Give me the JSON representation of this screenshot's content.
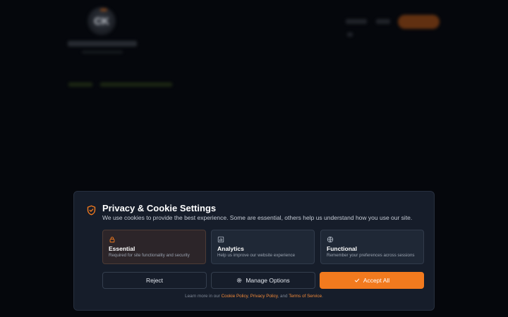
{
  "background": {
    "logo_initials": "CK"
  },
  "modal": {
    "title": "Privacy & Cookie Settings",
    "subtitle": "We use cookies to provide the best experience. Some are essential, others help us understand how you use our site.",
    "icon": "shield-check-icon",
    "cards": [
      {
        "icon": "lock-icon",
        "title": "Essential",
        "description": "Required for site functionality and security",
        "selected": true
      },
      {
        "icon": "bar-chart-icon",
        "title": "Analytics",
        "description": "Help us improve our website experience",
        "selected": false
      },
      {
        "icon": "globe-icon",
        "title": "Functional",
        "description": "Remember your preferences across sessions",
        "selected": false
      }
    ],
    "buttons": {
      "reject": "Reject",
      "manage": "Manage Options",
      "accept": "Accept All"
    },
    "footer": {
      "prefix": "Learn more in our ",
      "cookie_policy": "Cookie Policy",
      "sep1": ", ",
      "privacy_policy": "Privacy Policy",
      "sep2": ", and ",
      "terms": "Terms of Service",
      "suffix": "."
    }
  },
  "colors": {
    "accent": "#f27a1e",
    "modal_bg": "#161d2a",
    "page_bg": "#05070c"
  }
}
